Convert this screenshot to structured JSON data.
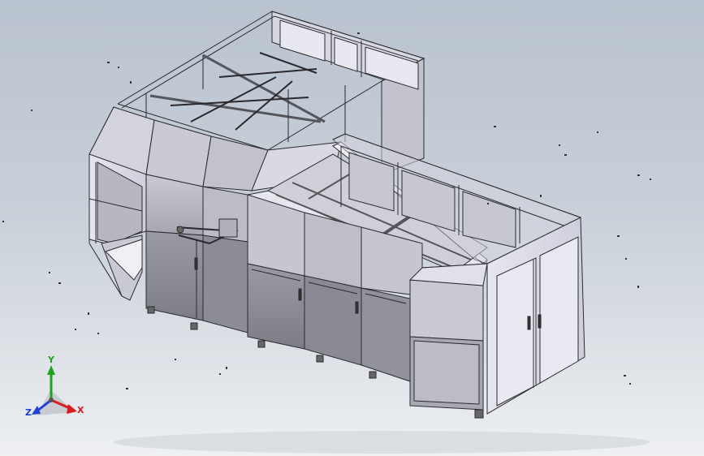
{
  "viewport": {
    "background_top": "#b9c3cf",
    "background_bottom": "#eef0f2",
    "model_face_light": "#dcdce6",
    "model_face_mid": "#bdbdc8",
    "model_face_dark": "#8f8f99",
    "model_edge": "#2a2a2e"
  },
  "triad": {
    "x_label": "X",
    "y_label": "Y",
    "z_label": "Z",
    "x_color": "#d81e1e",
    "y_color": "#1fa31f",
    "z_color": "#1f3fd8"
  }
}
